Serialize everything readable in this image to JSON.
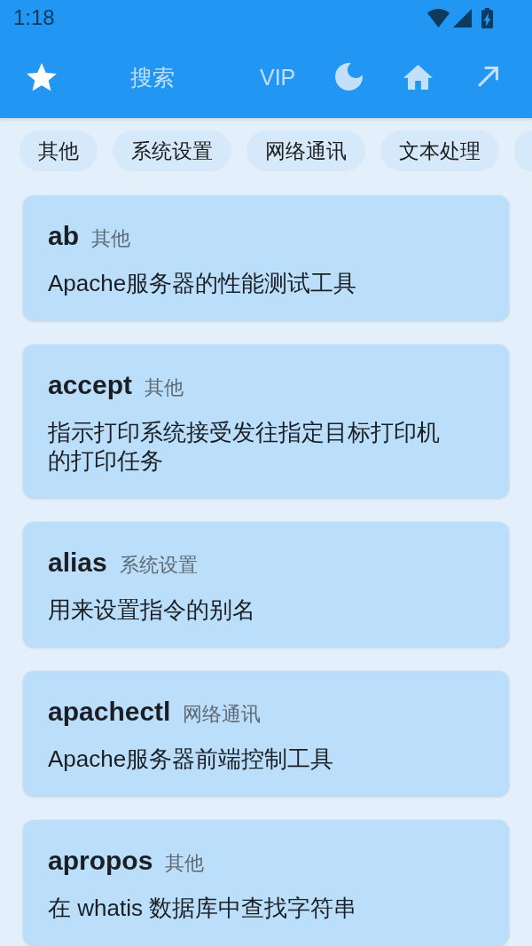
{
  "status_bar": {
    "time": "1:18"
  },
  "app_bar": {
    "actions": [
      {
        "kind": "icon",
        "selected": true
      },
      {
        "kind": "text",
        "label": "搜索",
        "selected": false
      },
      {
        "kind": "text",
        "label": "VIP",
        "selected": false
      },
      {
        "kind": "icon",
        "selected": false
      },
      {
        "kind": "icon",
        "selected": false
      },
      {
        "kind": "icon",
        "selected": false
      }
    ]
  },
  "categories": [
    "其他",
    "系统设置",
    "网络通讯",
    "文本处理"
  ],
  "commands": [
    {
      "name": "ab",
      "category": "其他",
      "description": "Apache服务器的性能测试工具"
    },
    {
      "name": "accept",
      "category": "其他",
      "description": "指示打印系统接受发往指定目标打印机的打印任务"
    },
    {
      "name": "alias",
      "category": "系统设置",
      "description": "用来设置指令的别名"
    },
    {
      "name": "apachectl",
      "category": "网络通讯",
      "description": "Apache服务器前端控制工具"
    },
    {
      "name": "apropos",
      "category": "其他",
      "description": "在 whatis 数据库中查找字符串"
    }
  ]
}
